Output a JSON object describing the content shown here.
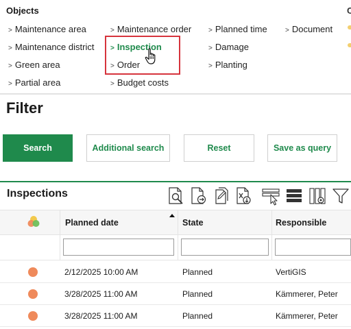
{
  "objects": {
    "title": "Objects",
    "edge_mark": "C",
    "columns": [
      {
        "items": [
          "Maintenance area",
          "Maintenance district",
          "Green area",
          "Partial area"
        ]
      },
      {
        "items": [
          "Maintenance order",
          "Inspection",
          "Order",
          "Budget costs"
        ]
      },
      {
        "items": [
          "Planned time",
          "Damage",
          "Planting"
        ]
      },
      {
        "items": [
          "Document"
        ]
      }
    ],
    "active_item": "Inspection",
    "chevron": ">"
  },
  "filter": {
    "title": "Filter",
    "buttons": {
      "search": "Search",
      "additional_search": "Additional search",
      "reset": "Reset",
      "save_as_query": "Save as query"
    }
  },
  "grid": {
    "title": "Inspections",
    "toolbar_icons": [
      "zoom-to-icon",
      "export-pdf-icon",
      "copy-document-icon",
      "export-excel-icon",
      "select-rows-icon",
      "column-layout-icon",
      "column-chooser-icon",
      "filter-icon"
    ],
    "columns": {
      "planned_date": "Planned date",
      "state": "State",
      "responsible": "Responsible"
    },
    "sort": {
      "column": "Planned date",
      "direction": "ascending"
    },
    "filters": {
      "planned_date": "",
      "state": "",
      "responsible": ""
    },
    "rows": [
      {
        "status_color": "#ef8a5b",
        "planned_date": "2/12/2025 10:00 AM",
        "state": "Planned",
        "responsible": "VertiGIS"
      },
      {
        "status_color": "#ef8a5b",
        "planned_date": "3/28/2025 11:00 AM",
        "state": "Planned",
        "responsible": "Kämmerer, Peter"
      },
      {
        "status_color": "#ef8a5b",
        "planned_date": "3/28/2025 11:00 AM",
        "state": "Planned",
        "responsible": "Kämmerer, Peter"
      }
    ]
  },
  "colors": {
    "accent": "#1f8a4c",
    "highlight": "#d6333c",
    "status_planned": "#ef8a5b"
  }
}
